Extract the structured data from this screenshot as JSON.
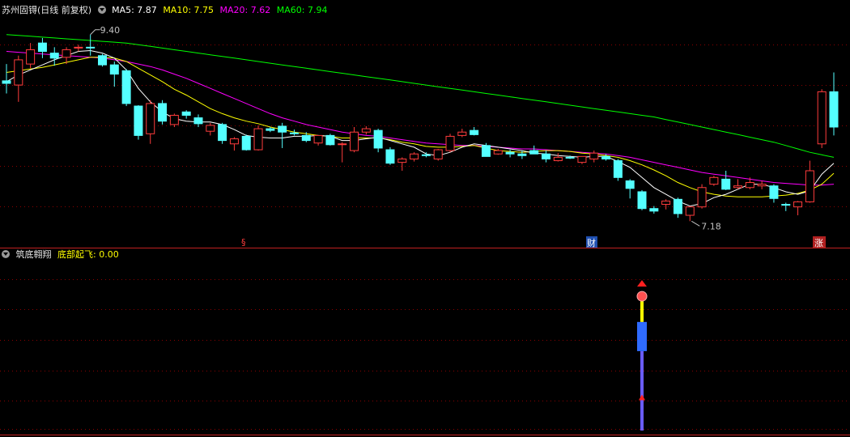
{
  "header": {
    "stock_name": "苏州固锝",
    "period": "(日线 前复权)",
    "ma_items": [
      {
        "label": "MA5: 7.87",
        "color": "#ffffff"
      },
      {
        "label": "MA10: 7.75",
        "color": "#ffff00"
      },
      {
        "label": "MA20: 7.62",
        "color": "#ff00ff"
      },
      {
        "label": "MA60: 7.94",
        "color": "#00ff00"
      }
    ]
  },
  "indicator": {
    "name": "筑底翱翔",
    "value_label": "底部起飞: 0.00",
    "value_color": "#ffff00"
  },
  "markers": {
    "high_label": "9.40",
    "low_label": "7.18",
    "event_1": "§",
    "event_2": "财",
    "event_3": "涨"
  },
  "colors": {
    "up": "#ff3c3c",
    "down": "#54ffff",
    "ma5": "#ffffff",
    "ma10": "#ffff00",
    "ma20": "#ff00ff",
    "ma60": "#00ff00",
    "grid": "#8b0000"
  },
  "chart_data": {
    "type": "candlestick",
    "ylim": [
      7.0,
      9.6
    ],
    "candles": [
      {
        "o": 8.85,
        "h": 9.05,
        "l": 8.7,
        "c": 8.82
      },
      {
        "o": 8.8,
        "h": 9.15,
        "l": 8.6,
        "c": 9.1
      },
      {
        "o": 9.05,
        "h": 9.3,
        "l": 9.0,
        "c": 9.22
      },
      {
        "o": 9.3,
        "h": 9.36,
        "l": 9.12,
        "c": 9.2
      },
      {
        "o": 9.18,
        "h": 9.25,
        "l": 9.03,
        "c": 9.12
      },
      {
        "o": 9.13,
        "h": 9.25,
        "l": 9.05,
        "c": 9.22
      },
      {
        "o": 9.24,
        "h": 9.28,
        "l": 9.2,
        "c": 9.25
      },
      {
        "o": 9.25,
        "h": 9.4,
        "l": 9.15,
        "c": 9.24
      },
      {
        "o": 9.15,
        "h": 9.17,
        "l": 9.02,
        "c": 9.04
      },
      {
        "o": 9.04,
        "h": 9.08,
        "l": 8.78,
        "c": 8.93
      },
      {
        "o": 8.97,
        "h": 8.99,
        "l": 8.55,
        "c": 8.58
      },
      {
        "o": 8.55,
        "h": 8.56,
        "l": 8.15,
        "c": 8.2
      },
      {
        "o": 8.22,
        "h": 8.62,
        "l": 8.1,
        "c": 8.58
      },
      {
        "o": 8.58,
        "h": 8.62,
        "l": 8.33,
        "c": 8.37
      },
      {
        "o": 8.33,
        "h": 8.46,
        "l": 8.3,
        "c": 8.44
      },
      {
        "o": 8.48,
        "h": 8.5,
        "l": 8.4,
        "c": 8.44
      },
      {
        "o": 8.41,
        "h": 8.45,
        "l": 8.3,
        "c": 8.34
      },
      {
        "o": 8.25,
        "h": 8.35,
        "l": 8.2,
        "c": 8.32
      },
      {
        "o": 8.33,
        "h": 8.35,
        "l": 8.1,
        "c": 8.14
      },
      {
        "o": 8.1,
        "h": 8.18,
        "l": 8.02,
        "c": 8.16
      },
      {
        "o": 8.19,
        "h": 8.21,
        "l": 8.02,
        "c": 8.03
      },
      {
        "o": 8.03,
        "h": 8.32,
        "l": 8.02,
        "c": 8.28
      },
      {
        "o": 8.28,
        "h": 8.3,
        "l": 8.24,
        "c": 8.26
      },
      {
        "o": 8.31,
        "h": 8.35,
        "l": 8.05,
        "c": 8.24
      },
      {
        "o": 8.23,
        "h": 8.27,
        "l": 8.2,
        "c": 8.22
      },
      {
        "o": 8.2,
        "h": 8.24,
        "l": 8.12,
        "c": 8.14
      },
      {
        "o": 8.11,
        "h": 8.2,
        "l": 8.08,
        "c": 8.2
      },
      {
        "o": 8.2,
        "h": 8.22,
        "l": 8.08,
        "c": 8.09
      },
      {
        "o": 8.1,
        "h": 8.12,
        "l": 7.88,
        "c": 8.1
      },
      {
        "o": 8.02,
        "h": 8.3,
        "l": 8.0,
        "c": 8.24
      },
      {
        "o": 8.24,
        "h": 8.31,
        "l": 8.21,
        "c": 8.28
      },
      {
        "o": 8.26,
        "h": 8.28,
        "l": 8.0,
        "c": 8.05
      },
      {
        "o": 8.03,
        "h": 8.06,
        "l": 7.85,
        "c": 7.87
      },
      {
        "o": 7.88,
        "h": 7.94,
        "l": 7.78,
        "c": 7.92
      },
      {
        "o": 7.92,
        "h": 8.0,
        "l": 7.89,
        "c": 7.98
      },
      {
        "o": 7.97,
        "h": 8.0,
        "l": 7.94,
        "c": 7.96
      },
      {
        "o": 7.92,
        "h": 8.04,
        "l": 7.9,
        "c": 8.03
      },
      {
        "o": 8.02,
        "h": 8.22,
        "l": 8.0,
        "c": 8.19
      },
      {
        "o": 8.2,
        "h": 8.28,
        "l": 8.18,
        "c": 8.24
      },
      {
        "o": 8.26,
        "h": 8.3,
        "l": 8.2,
        "c": 8.21
      },
      {
        "o": 8.08,
        "h": 8.11,
        "l": 7.95,
        "c": 7.95
      },
      {
        "o": 7.98,
        "h": 8.04,
        "l": 7.97,
        "c": 8.02
      },
      {
        "o": 8.0,
        "h": 8.03,
        "l": 7.94,
        "c": 7.98
      },
      {
        "o": 7.98,
        "h": 8.02,
        "l": 7.92,
        "c": 7.96
      },
      {
        "o": 8.02,
        "h": 8.08,
        "l": 7.98,
        "c": 7.98
      },
      {
        "o": 7.98,
        "h": 8.02,
        "l": 7.88,
        "c": 7.92
      },
      {
        "o": 7.9,
        "h": 7.99,
        "l": 7.89,
        "c": 7.94
      },
      {
        "o": 7.94,
        "h": 7.96,
        "l": 7.92,
        "c": 7.93
      },
      {
        "o": 7.88,
        "h": 7.95,
        "l": 7.86,
        "c": 7.95
      },
      {
        "o": 7.92,
        "h": 8.02,
        "l": 7.88,
        "c": 7.99
      },
      {
        "o": 7.95,
        "h": 7.98,
        "l": 7.9,
        "c": 7.92
      },
      {
        "o": 7.9,
        "h": 7.92,
        "l": 7.66,
        "c": 7.7
      },
      {
        "o": 7.66,
        "h": 7.68,
        "l": 7.45,
        "c": 7.57
      },
      {
        "o": 7.53,
        "h": 7.55,
        "l": 7.31,
        "c": 7.33
      },
      {
        "o": 7.33,
        "h": 7.36,
        "l": 7.27,
        "c": 7.3
      },
      {
        "o": 7.38,
        "h": 7.44,
        "l": 7.32,
        "c": 7.42
      },
      {
        "o": 7.44,
        "h": 7.46,
        "l": 7.22,
        "c": 7.27
      },
      {
        "o": 7.25,
        "h": 7.36,
        "l": 7.18,
        "c": 7.35
      },
      {
        "o": 7.35,
        "h": 7.62,
        "l": 7.33,
        "c": 7.58
      },
      {
        "o": 7.62,
        "h": 7.72,
        "l": 7.6,
        "c": 7.7
      },
      {
        "o": 7.68,
        "h": 7.78,
        "l": 7.55,
        "c": 7.56
      },
      {
        "o": 7.58,
        "h": 7.68,
        "l": 7.56,
        "c": 7.6
      },
      {
        "o": 7.58,
        "h": 7.7,
        "l": 7.56,
        "c": 7.64
      },
      {
        "o": 7.6,
        "h": 7.66,
        "l": 7.56,
        "c": 7.62
      },
      {
        "o": 7.6,
        "h": 7.62,
        "l": 7.4,
        "c": 7.45
      },
      {
        "o": 7.38,
        "h": 7.4,
        "l": 7.3,
        "c": 7.37
      },
      {
        "o": 7.35,
        "h": 7.42,
        "l": 7.25,
        "c": 7.41
      },
      {
        "o": 7.41,
        "h": 7.9,
        "l": 7.4,
        "c": 7.78
      },
      {
        "o": 8.1,
        "h": 8.75,
        "l": 8.05,
        "c": 8.72
      },
      {
        "o": 8.72,
        "h": 8.95,
        "l": 8.2,
        "c": 8.3
      }
    ],
    "ma5": [
      8.84,
      8.92,
      8.98,
      9.04,
      9.1,
      9.15,
      9.2,
      9.21,
      9.18,
      9.12,
      8.98,
      8.76,
      8.6,
      8.48,
      8.4,
      8.37,
      8.36,
      8.36,
      8.33,
      8.27,
      8.2,
      8.18,
      8.17,
      8.17,
      8.19,
      8.19,
      8.2,
      8.19,
      8.14,
      8.14,
      8.16,
      8.18,
      8.14,
      8.1,
      8.06,
      7.98,
      7.96,
      8.0,
      8.06,
      8.1,
      8.08,
      8.06,
      8.04,
      8.02,
      7.99,
      7.98,
      7.96,
      7.95,
      7.94,
      7.95,
      7.95,
      7.89,
      7.82,
      7.7,
      7.58,
      7.5,
      7.42,
      7.36,
      7.39,
      7.46,
      7.5,
      7.56,
      7.62,
      7.62,
      7.58,
      7.53,
      7.5,
      7.54,
      7.74,
      7.87
    ],
    "ma10": [
      8.95,
      8.97,
      8.99,
      9.01,
      9.04,
      9.07,
      9.1,
      9.13,
      9.13,
      9.12,
      9.08,
      9.0,
      8.92,
      8.84,
      8.75,
      8.68,
      8.6,
      8.52,
      8.46,
      8.41,
      8.37,
      8.34,
      8.3,
      8.27,
      8.24,
      8.22,
      8.2,
      8.19,
      8.17,
      8.17,
      8.17,
      8.17,
      8.15,
      8.12,
      8.1,
      8.07,
      8.06,
      8.06,
      8.07,
      8.08,
      8.05,
      8.02,
      8.01,
      8.0,
      8.01,
      8.02,
      8.02,
      8.01,
      7.99,
      7.98,
      7.96,
      7.94,
      7.9,
      7.85,
      7.79,
      7.72,
      7.64,
      7.58,
      7.53,
      7.5,
      7.48,
      7.47,
      7.47,
      7.47,
      7.48,
      7.49,
      7.51,
      7.55,
      7.62,
      7.75
    ],
    "ma20": [
      9.2,
      9.19,
      9.18,
      9.17,
      9.16,
      9.15,
      9.14,
      9.13,
      9.12,
      9.1,
      9.08,
      9.05,
      9.02,
      8.98,
      8.93,
      8.88,
      8.82,
      8.76,
      8.7,
      8.64,
      8.58,
      8.52,
      8.46,
      8.41,
      8.37,
      8.33,
      8.3,
      8.27,
      8.24,
      8.22,
      8.2,
      8.19,
      8.17,
      8.15,
      8.13,
      8.11,
      8.1,
      8.09,
      8.08,
      8.08,
      8.07,
      8.06,
      8.05,
      8.04,
      8.04,
      8.03,
      8.02,
      8.01,
      8.0,
      7.99,
      7.98,
      7.96,
      7.94,
      7.91,
      7.88,
      7.85,
      7.82,
      7.79,
      7.76,
      7.74,
      7.72,
      7.7,
      7.68,
      7.66,
      7.64,
      7.63,
      7.62,
      7.61,
      7.61,
      7.62
    ],
    "ma60": [
      9.4,
      9.39,
      9.38,
      9.37,
      9.36,
      9.35,
      9.34,
      9.33,
      9.32,
      9.31,
      9.3,
      9.28,
      9.26,
      9.24,
      9.22,
      9.2,
      9.18,
      9.16,
      9.14,
      9.12,
      9.1,
      9.08,
      9.06,
      9.04,
      9.02,
      9.0,
      8.98,
      8.96,
      8.94,
      8.92,
      8.9,
      8.88,
      8.86,
      8.84,
      8.82,
      8.8,
      8.78,
      8.76,
      8.74,
      8.72,
      8.7,
      8.68,
      8.66,
      8.64,
      8.62,
      8.6,
      8.58,
      8.56,
      8.54,
      8.52,
      8.5,
      8.48,
      8.46,
      8.44,
      8.42,
      8.39,
      8.36,
      8.33,
      8.3,
      8.27,
      8.24,
      8.21,
      8.18,
      8.15,
      8.12,
      8.08,
      8.04,
      8.0,
      7.97,
      7.94
    ],
    "signal": {
      "bar_index": 53,
      "segments": [
        {
          "from": 0.0,
          "to": 0.18,
          "color": "#6a5cff"
        },
        {
          "from": 0.18,
          "to": 0.68,
          "color": "#6a5cff"
        },
        {
          "from": 0.68,
          "to": 0.93,
          "color": "#2f6bff"
        },
        {
          "from": 0.93,
          "to": 1.15,
          "color": "#ffff00"
        }
      ],
      "ylim": [
        0,
        1.4
      ]
    }
  }
}
